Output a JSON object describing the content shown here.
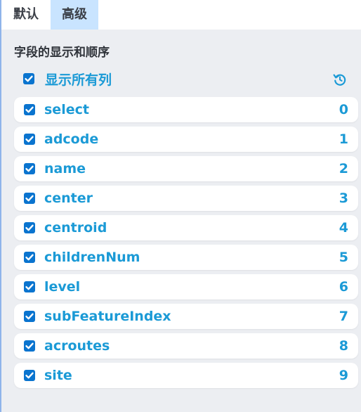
{
  "tabs": [
    {
      "label": "默认",
      "active": false
    },
    {
      "label": "高级",
      "active": true
    }
  ],
  "section_title": "字段的显示和顺序",
  "show_all": {
    "label": "显示所有列",
    "checked": true
  },
  "reset_icon": "reset-icon",
  "colors": {
    "accent": "#1b9ad6",
    "checkbox": "#0a74cf",
    "active_tab": "#c9e4ff",
    "panel_bg": "#eceef2"
  },
  "fields": [
    {
      "name": "select",
      "index": "0",
      "checked": true
    },
    {
      "name": "adcode",
      "index": "1",
      "checked": true
    },
    {
      "name": "name",
      "index": "2",
      "checked": true
    },
    {
      "name": "center",
      "index": "3",
      "checked": true
    },
    {
      "name": "centroid",
      "index": "4",
      "checked": true
    },
    {
      "name": "childrenNum",
      "index": "5",
      "checked": true
    },
    {
      "name": "level",
      "index": "6",
      "checked": true
    },
    {
      "name": "subFeatureIndex",
      "index": "7",
      "checked": true
    },
    {
      "name": "acroutes",
      "index": "8",
      "checked": true
    },
    {
      "name": "site",
      "index": "9",
      "checked": true
    }
  ]
}
